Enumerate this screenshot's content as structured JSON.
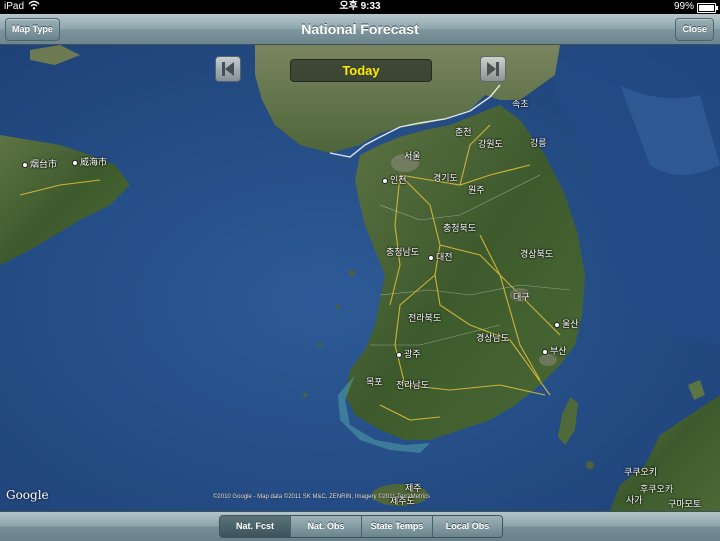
{
  "status_bar": {
    "device": "iPad",
    "time": "오후 9:33",
    "battery_percent": "99%",
    "battery_level": 0.99,
    "wifi_icon": "wifi-icon"
  },
  "nav_bar": {
    "title": "National Forecast",
    "map_type_label": "Map Type",
    "close_label": "Close"
  },
  "map": {
    "day_label": "Today",
    "prev_icon": "skip-back-icon",
    "next_icon": "skip-forward-icon",
    "google_logo": "Google",
    "copyright": "©2010 Google -  Map data ©2011 SK M&C, ZENRIN, Imagery ©2011 TerraMetrics",
    "labels": {
      "yantai": "烟台市",
      "weihai": "威海市",
      "seoul": "서울",
      "incheon": "인천",
      "chuncheon": "춘천",
      "gangwon": "강원도",
      "gangneung": "강릉",
      "sokcho": "속초",
      "gyeonggi": "경기도",
      "wonju": "원주",
      "chungbuk": "충청북도",
      "chungnam": "충청남도",
      "daejeon": "대전",
      "gyeongbuk": "경상북도",
      "jeonbuk": "전라북도",
      "daegu": "대구",
      "ulsan": "울산",
      "gyeongnam": "경상남도",
      "busan": "부산",
      "gwangju": "광주",
      "mokpo": "목포",
      "jeonnam": "전라남도",
      "jeju1": "제주",
      "jeju2": "제주도",
      "kokura": "쿠쿠오키",
      "fukuoka": "후쿠오카",
      "saga": "사가",
      "kumamoto": "구마모토"
    }
  },
  "toolbar": {
    "tabs": [
      "Nat. Fcst",
      "Nat. Obs",
      "State Temps",
      "Local Obs"
    ],
    "active_tab": "Nat. Fcst"
  }
}
